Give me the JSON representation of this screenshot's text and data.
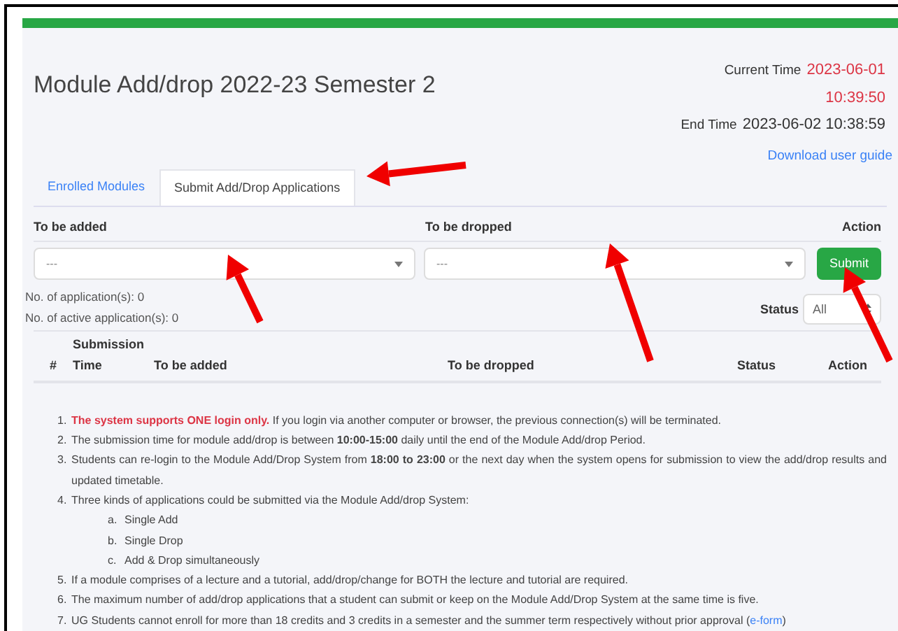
{
  "title": "Module Add/drop 2022-23 Semester 2",
  "current_time": {
    "label": "Current Time",
    "date": "2023-06-01",
    "time": "10:39:50"
  },
  "end_time": {
    "label": "End Time",
    "value": "2023-06-02 10:38:59"
  },
  "guide_link": "Download user guide",
  "tabs": [
    {
      "label": "Enrolled Modules",
      "selected": false
    },
    {
      "label": "Submit Add/Drop Applications",
      "selected": true
    }
  ],
  "form": {
    "added_label": "To be added",
    "dropped_label": "To be dropped",
    "action_label": "Action",
    "added_value": "---",
    "dropped_value": "---",
    "submit": "Submit"
  },
  "counts": [
    "No. of application(s): 0",
    "No. of active application(s): 0"
  ],
  "status_filter": {
    "label": "Status",
    "value": "All"
  },
  "table": {
    "columns": [
      "#",
      "Submission Time",
      "To be added",
      "To be dropped",
      "Status",
      "Action"
    ]
  },
  "notes": [
    {
      "number": "1.",
      "lead": "The system supports ONE login only.",
      "text": " If you login via another computer or browser, the previous connection(s) will be terminated."
    },
    {
      "number": "2.",
      "text": "The submission time for module add/drop is between **10:00-15:00** daily until the end of the Module Add/drop Period."
    },
    {
      "number": "3.",
      "text": "Students can re-login to the Module Add/Drop System from **18:00 to 23:00** or the next day when the system opens for submission to view the add/drop results and updated timetable."
    },
    {
      "number": "4.",
      "text": "Three kinds of applications could be submitted via the Module Add/drop System:",
      "children": [
        {
          "marker": "a.",
          "text": "Single Add"
        },
        {
          "marker": "b.",
          "text": "Single Drop"
        },
        {
          "marker": "c.",
          "text": "Add & Drop simultaneously"
        }
      ]
    },
    {
      "number": "5.",
      "text": "If a module comprises of a lecture and a tutorial, add/drop/change for BOTH the lecture and tutorial are required."
    },
    {
      "number": "6.",
      "text": "The maximum number of add/drop applications that a student can submit or keep on the Module Add/Drop System at the same time is five."
    },
    {
      "number": "7.",
      "text": "UG Students cannot enroll for more than 18 credits and 3 credits in a semester and the summer term respectively without prior approval (",
      "link": "e-form",
      "after": ")"
    }
  ],
  "arrow_annotations": [
    {
      "kind": "arrow"
    },
    {
      "kind": "arrow"
    },
    {
      "kind": "arrow"
    },
    {
      "kind": "arrow"
    }
  ]
}
